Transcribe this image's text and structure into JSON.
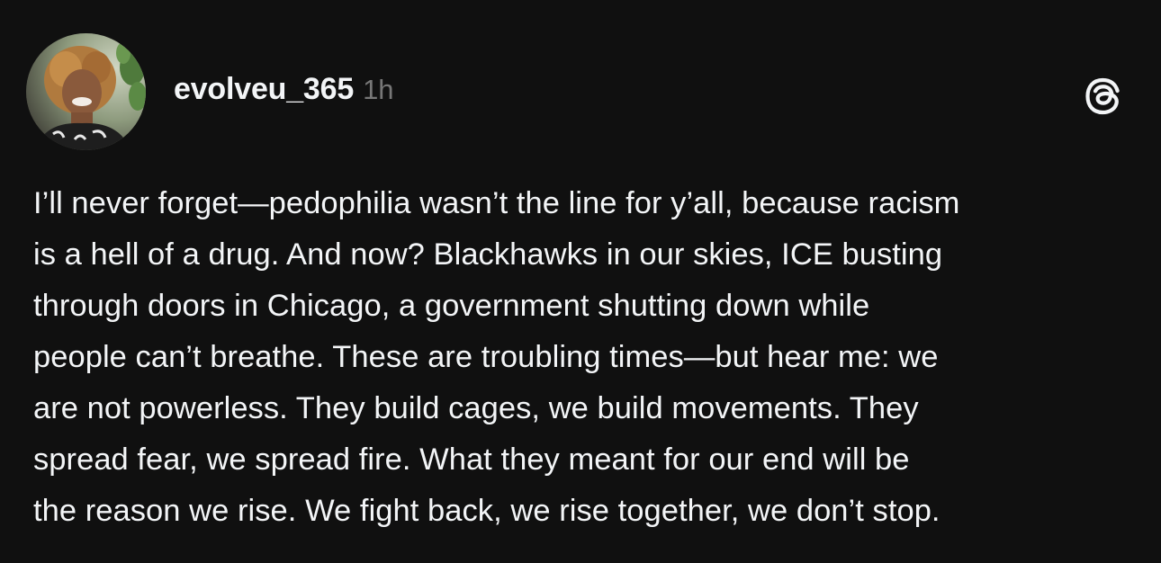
{
  "post": {
    "author": {
      "username": "evolveu_365",
      "avatar_icon": "profile-photo"
    },
    "timestamp": "1h",
    "app_icon": "threads-logo-icon",
    "body_lines": [
      "I’ll never forget—pedophilia wasn’t the line for y’all, because racism",
      "is a hell of a drug. And now? Blackhawks in our skies, ICE busting",
      "through doors in Chicago, a government shutting down while",
      "people can’t breathe. These are troubling times—but hear me: we",
      "are not powerless. They build cages, we build movements. They",
      "spread fear, we spread fire. What they meant for our end will be",
      "the reason we rise. We fight back, we rise together, we don’t stop."
    ]
  },
  "colors": {
    "background": "#101010",
    "text_primary": "#f3f5f7",
    "text_secondary": "#777777"
  }
}
